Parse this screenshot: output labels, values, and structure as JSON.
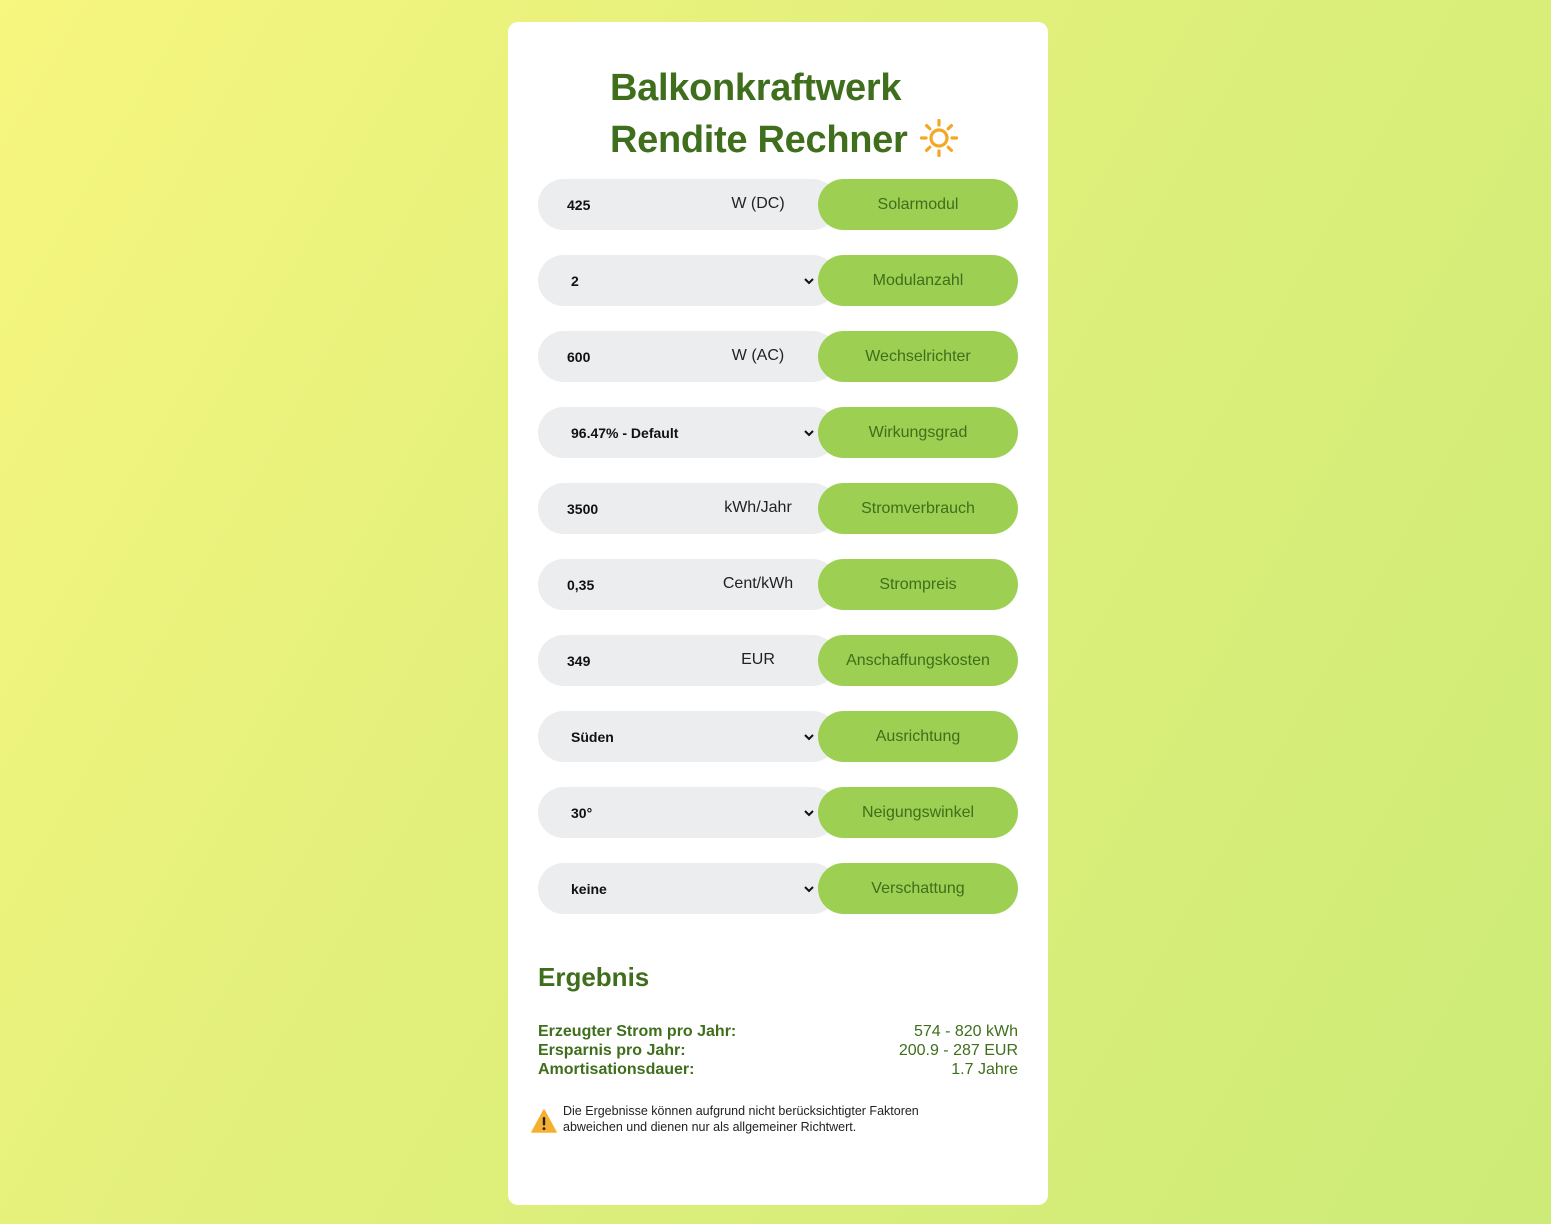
{
  "header": {
    "title_line1": "Balkonkraftwerk",
    "title_line2": "Rendite Rechner",
    "icon": "sun-icon"
  },
  "fields": [
    {
      "value": "425",
      "unit": "W (DC)",
      "label": "Solarmodul",
      "type": "number"
    },
    {
      "value": "2",
      "unit": "",
      "label": "Modulanzahl",
      "type": "select"
    },
    {
      "value": "600",
      "unit": "W (AC)",
      "label": "Wechselrichter",
      "type": "number"
    },
    {
      "value": "96.47% - Default",
      "unit": "",
      "label": "Wirkungsgrad",
      "type": "select"
    },
    {
      "value": "3500",
      "unit": "kWh/Jahr",
      "label": "Stromverbrauch",
      "type": "number"
    },
    {
      "value": "0,35",
      "unit": "Cent/kWh",
      "label": "Strompreis",
      "type": "number"
    },
    {
      "value": "349",
      "unit": "EUR",
      "label": "Anschaffungskosten",
      "type": "number"
    },
    {
      "value": "Süden",
      "unit": "",
      "label": "Ausrichtung",
      "type": "select"
    },
    {
      "value": "30°",
      "unit": "",
      "label": "Neigungswinkel",
      "type": "select"
    },
    {
      "value": "keine",
      "unit": "",
      "label": "Verschattung",
      "type": "select"
    }
  ],
  "result": {
    "title": "Ergebnis",
    "rows": [
      {
        "label": "Erzeugter Strom pro Jahr:",
        "value": "574 - 820 kWh"
      },
      {
        "label": "Ersparnis pro Jahr:",
        "value": "200.9 - 287 EUR"
      },
      {
        "label": "Amortisationsdauer:",
        "value": "1.7 Jahre"
      }
    ]
  },
  "note": {
    "icon": "warning-icon",
    "text_line1": "Die Ergebnisse können aufgrund nicht berücksichtigter Faktoren",
    "text_line2": "abweichen und dienen nur als allgemeiner Richtwert."
  },
  "colors": {
    "primary_green": "#3f6e1c",
    "pill_green": "#9dcf52",
    "field_gray": "#ecedee",
    "sun_orange": "#f5a623",
    "warning_yellow": "#f5b031"
  }
}
